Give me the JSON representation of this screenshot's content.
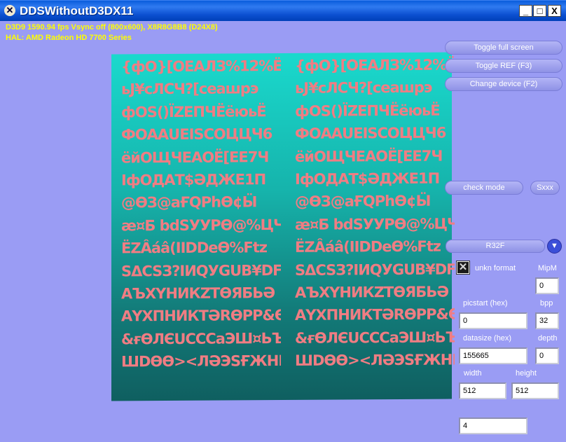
{
  "window": {
    "title": "DDSWithoutD3DX11",
    "icon": "dx-icon",
    "controls": [
      "_",
      "□",
      "X"
    ]
  },
  "stats": {
    "line1": "D3D9 1590.94 fps Vsync off (800x600), X8R8G8B8 (D24X8)",
    "line2": "HAL: AMD Radeon HD 7700 Series"
  },
  "buttons": {
    "toggle_full_screen": "Toggle full screen",
    "toggle_ref": "Toggle REF (F3)",
    "change_device": "Change device (F2)",
    "check_mode": "check mode",
    "sxxx": "Sxxx"
  },
  "format": {
    "selected": "R32F",
    "arrow": "▼"
  },
  "unkn_format": {
    "label": "unkn format",
    "checked": true,
    "mark": "✕"
  },
  "fields": {
    "mipm": {
      "label": "MipM",
      "value": "0"
    },
    "picstart": {
      "label": "picstart  (hex)",
      "value": "0"
    },
    "bpp": {
      "label": "bpp",
      "value": "32"
    },
    "datasize": {
      "label": "datasize  (hex)",
      "value": "155665"
    },
    "depth": {
      "label": "depth",
      "value": "0"
    },
    "width": {
      "label": "width",
      "value": "512"
    },
    "height": {
      "label": "height",
      "value": "512"
    },
    "extra": {
      "value": "4"
    }
  },
  "texture": {
    "gradient": [
      "#1ad9cd",
      "#0f5f60"
    ],
    "glyph_color": "#f07d83",
    "rows": [
      "{фО}[ОЕАЛЗ%12%Ё",
      "ьJ¥сЛСЧ?[сеашрэ",
      "фОS()ЇZЕПЧЁёюьЁ",
      "ФОААUЕISСОЦЦЧ6",
      "ёйОЩЧЕАОЁ[ЕЕ7Ч",
      "ІфОДАТ$ӘДЖЕ1П",
      "@ӨЗ@аҒQРһӨ¢Ӹ",
      "æ¤Б bdSУУРӨ@%ЦЧ",
      "ЁZÂáâ(ІІDDеӨ%Ftz",
      "ЅΔCSЗ?IИQУGUВ¥DF",
      "АЪХҮНИКZТӨЯБЬӘ",
      "АҮХПНИКТӘRӨРР&Ө",
      "&ғӨЛЄUCCCaЭШ¤ЬЪ",
      "ШDӨӨ><ЛӘЭЅҒЖНЫХХ"
    ]
  }
}
